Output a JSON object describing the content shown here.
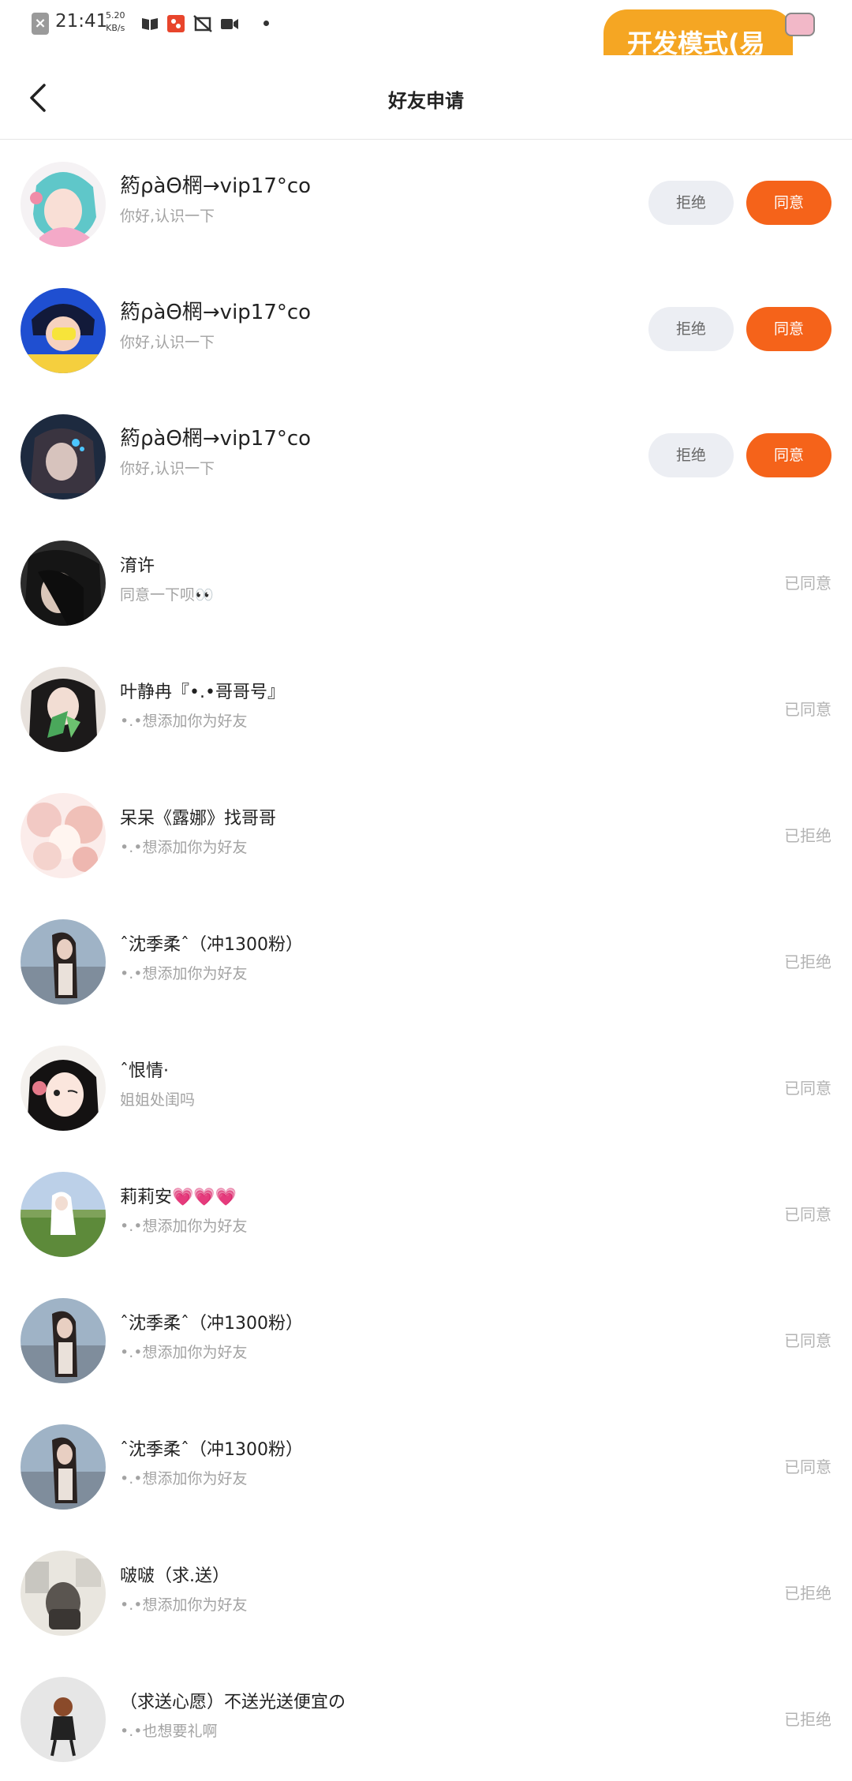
{
  "status_bar": {
    "time": "21:41",
    "speed_value": "5.20",
    "speed_unit": "KB/s",
    "dev_badge": "开发模式(易"
  },
  "header": {
    "title": "好友申请"
  },
  "buttons": {
    "reject": "拒绝",
    "accept": "同意"
  },
  "requests": [
    {
      "name": "箹ρàΘ棢→vip17°co",
      "message": "你好,认识一下",
      "pending": true
    },
    {
      "name": "箹ρàΘ棢→vip17°co",
      "message": "你好,认识一下",
      "pending": true
    },
    {
      "name": "箹ρàΘ棢→vip17°co",
      "message": "你好,认识一下",
      "pending": true
    },
    {
      "name": "淯许",
      "message": "同意一下呗👀",
      "status": "已同意"
    },
    {
      "name": "叶静冉『•.•哥哥号』",
      "message": "•.•想添加你为好友",
      "status": "已同意"
    },
    {
      "name": "呆呆《露娜》找哥哥",
      "message": "•.•想添加你为好友",
      "status": "已拒绝"
    },
    {
      "name": "ˆ沈季柔ˆ（冲1300粉）",
      "message": "•.•想添加你为好友",
      "status": "已拒绝"
    },
    {
      "name": "ˆ恨情·",
      "message": "姐姐处闺吗",
      "status": "已同意"
    },
    {
      "name": "莉莉安💗💗💗",
      "message": "•.•想添加你为好友",
      "status": "已同意"
    },
    {
      "name": "ˆ沈季柔ˆ（冲1300粉）",
      "message": "•.•想添加你为好友",
      "status": "已同意"
    },
    {
      "name": "ˆ沈季柔ˆ（冲1300粉）",
      "message": "•.•想添加你为好友",
      "status": "已同意"
    },
    {
      "name": "啵啵（求.送）",
      "message": "•.•想添加你为好友",
      "status": "已拒绝"
    },
    {
      "name": "（求送心愿）不送光送便宜の",
      "message": "•.•也想要礼啊",
      "status": "已拒绝"
    }
  ]
}
